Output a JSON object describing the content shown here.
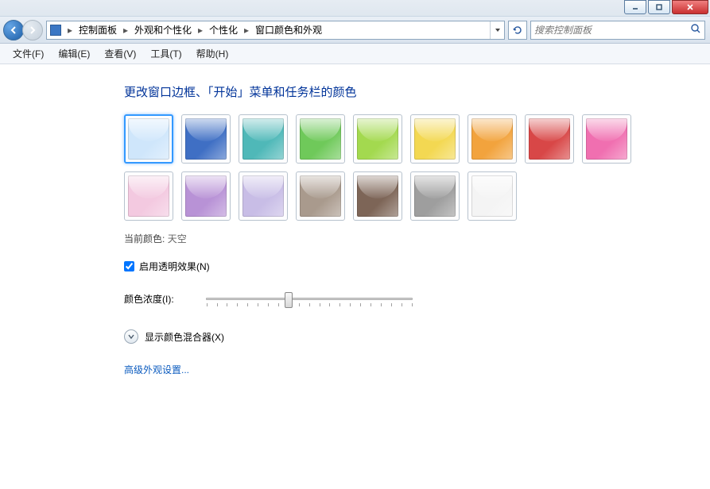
{
  "window": {
    "minimize_tooltip": "最小化",
    "maximize_tooltip": "最大化",
    "close_tooltip": "关闭"
  },
  "breadcrumb": {
    "items": [
      "控制面板",
      "外观和个性化",
      "个性化",
      "窗口颜色和外观"
    ]
  },
  "search": {
    "placeholder": "搜索控制面板"
  },
  "menu": {
    "file": "文件(F)",
    "edit": "编辑(E)",
    "view": "查看(V)",
    "tools": "工具(T)",
    "help": "帮助(H)"
  },
  "page": {
    "heading": "更改窗口边框、「开始」菜单和任务栏的颜色",
    "current_color_label": "当前颜色:",
    "current_color_value": "天空",
    "transparency_label": "启用透明效果(N)",
    "transparency_checked": true,
    "intensity_label": "颜色浓度(I):",
    "intensity_value": 40,
    "mixer_label": "显示颜色混合器(X)",
    "advanced_link": "高级外观设置..."
  },
  "swatches": [
    {
      "name": "sky",
      "color": "#cfe6fb",
      "selected": true
    },
    {
      "name": "twilight",
      "color": "#3f6fc4",
      "selected": false
    },
    {
      "name": "sea",
      "color": "#4fb8b8",
      "selected": false
    },
    {
      "name": "leaf",
      "color": "#6fc95a",
      "selected": false
    },
    {
      "name": "lime",
      "color": "#a3d94f",
      "selected": false
    },
    {
      "name": "sun",
      "color": "#f3d852",
      "selected": false
    },
    {
      "name": "pumpkin",
      "color": "#f2a33d",
      "selected": false
    },
    {
      "name": "ruby",
      "color": "#d84747",
      "selected": false
    },
    {
      "name": "fuchsia",
      "color": "#f06fb0",
      "selected": false
    },
    {
      "name": "blush",
      "color": "#f3c9e0",
      "selected": false
    },
    {
      "name": "violet",
      "color": "#b892d6",
      "selected": false
    },
    {
      "name": "lavender",
      "color": "#c8bde6",
      "selected": false
    },
    {
      "name": "taupe",
      "color": "#a99a8d",
      "selected": false
    },
    {
      "name": "chocolate",
      "color": "#7d6557",
      "selected": false
    },
    {
      "name": "slate",
      "color": "#9e9e9e",
      "selected": false
    },
    {
      "name": "frost",
      "color": "#f4f4f4",
      "selected": false
    }
  ]
}
